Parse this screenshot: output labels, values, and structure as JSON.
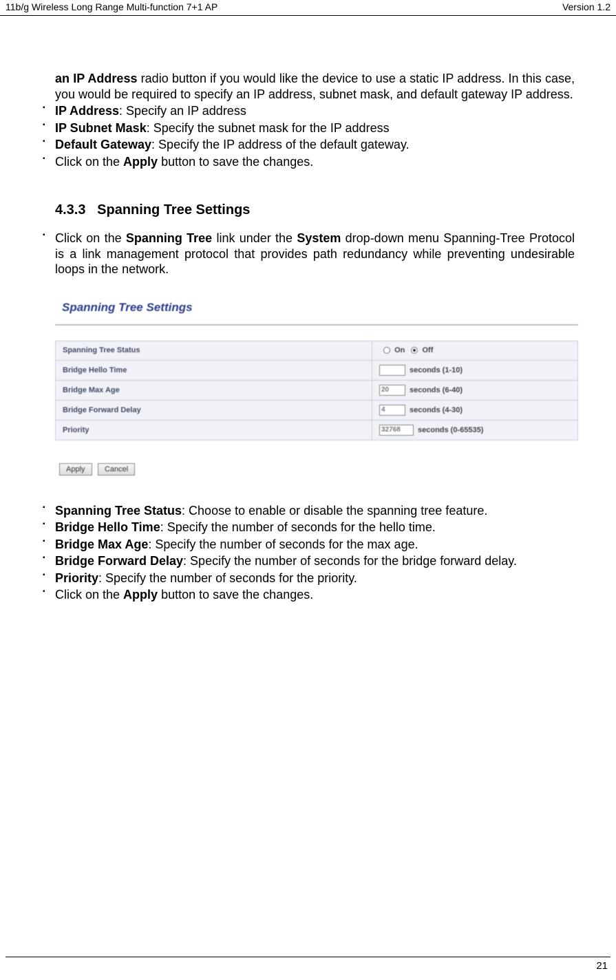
{
  "header": {
    "left": "11b/g Wireless Long Range Multi-function 7+1 AP",
    "right": "Version 1.2"
  },
  "intro": {
    "lead_bold": "an IP Address",
    "lead_rest": " radio button if you would like the device to use a static IP address. In this case, you would be required to specify an IP address, subnet mask, and default gateway IP address."
  },
  "list1": [
    {
      "bold": "IP Address",
      "rest": ": Specify an IP address"
    },
    {
      "bold": "IP Subnet Mask",
      "rest": ": Specify the subnet mask for the IP address"
    },
    {
      "bold": "Default Gateway",
      "rest": ": Specify the IP address of the default gateway."
    },
    {
      "pre": "Click on the ",
      "bold": "Apply",
      "rest": " button to save the changes."
    }
  ],
  "section": {
    "num": "4.3.3",
    "title": "Spanning Tree Settings"
  },
  "para2": {
    "pre": "Click on the ",
    "bold1": "Spanning Tree",
    "mid": " link under the ",
    "bold2": "System",
    "rest": " drop-down menu Spanning-Tree Protocol is a link management protocol that provides path redundancy while preventing undesirable loops in the network."
  },
  "panel": {
    "title": "Spanning Tree Settings",
    "rows": {
      "status": {
        "label": "Spanning Tree Status",
        "on": "On",
        "off": "Off",
        "selected": "off"
      },
      "hello": {
        "label": "Bridge Hello Time",
        "value": "",
        "suffix": "seconds (1-10)"
      },
      "maxage": {
        "label": "Bridge Max Age",
        "value": "20",
        "suffix": "seconds (6-40)"
      },
      "fwd": {
        "label": "Bridge Forward Delay",
        "value": "4",
        "suffix": "seconds (4-30)"
      },
      "prio": {
        "label": "Priority",
        "value": "32768",
        "suffix": "seconds (0-65535)"
      }
    },
    "buttons": {
      "apply": "Apply",
      "cancel": "Cancel"
    }
  },
  "list2": [
    {
      "bold": "Spanning Tree Status",
      "rest": ": Choose to enable or disable the spanning tree feature."
    },
    {
      "bold": "Bridge Hello Time",
      "rest": ": Specify the number of seconds for the hello time."
    },
    {
      "bold": "Bridge Max Age",
      "rest": ": Specify the number of seconds for the max age."
    },
    {
      "bold": "Bridge Forward Delay",
      "rest": ": Specify the number of seconds for the bridge forward delay."
    },
    {
      "bold": "Priority",
      "rest": ": Specify the number of seconds for the priority."
    },
    {
      "pre": "Click on the ",
      "bold": "Apply",
      "rest": " button to save the changes."
    }
  ],
  "footer": {
    "page": "21"
  }
}
